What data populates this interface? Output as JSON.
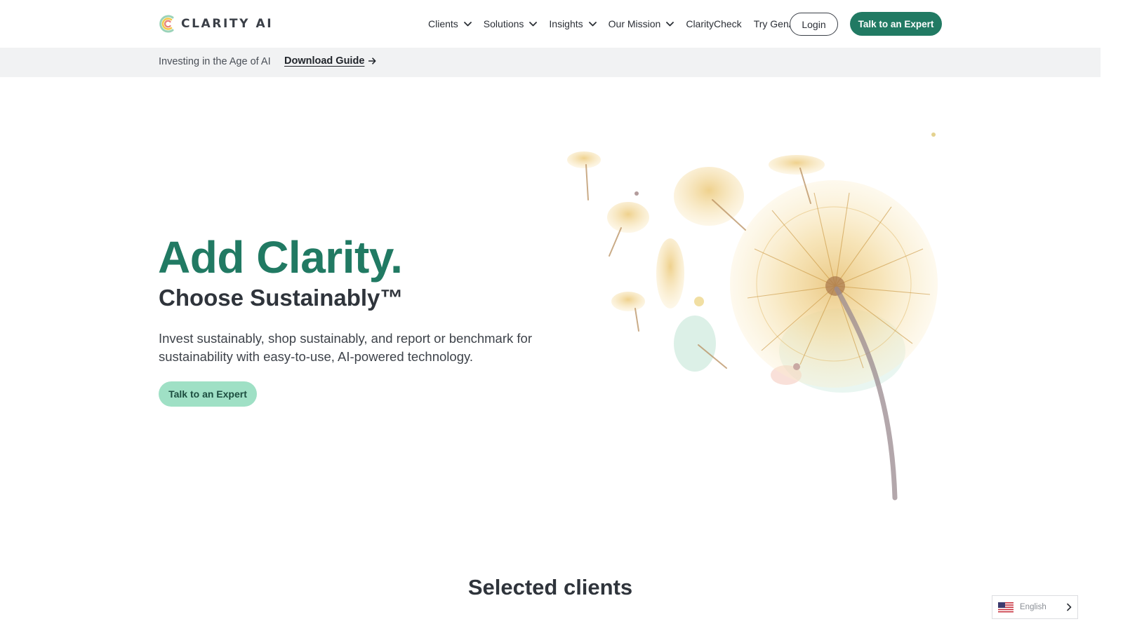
{
  "header": {
    "logo_text": "CLARITY AI",
    "nav": [
      {
        "label": "Clients",
        "has_dropdown": true
      },
      {
        "label": "Solutions",
        "has_dropdown": true
      },
      {
        "label": "Insights",
        "has_dropdown": true
      },
      {
        "label": "Our Mission",
        "has_dropdown": true
      },
      {
        "label": "ClarityCheck",
        "has_dropdown": false
      },
      {
        "label": "Try GenAI",
        "has_dropdown": false
      }
    ],
    "login_label": "Login",
    "cta_label": "Talk to an Expert"
  },
  "announcement": {
    "text": "Investing in the Age of AI",
    "link_label": "Download Guide"
  },
  "hero": {
    "title": "Add Clarity.",
    "subtitle": "Choose Sustainably™",
    "description": "Invest sustainably, shop sustainably, and report or benchmark for sustainability with easy-to-use, AI-powered technology.",
    "cta_label": "Talk to an Expert"
  },
  "clients_section": {
    "title": "Selected clients"
  },
  "language_selector": {
    "label": "English",
    "flag": "us-flag-icon"
  },
  "colors": {
    "brand_green": "#217a63",
    "mint": "#9fe0c5",
    "announce_bg": "#f1f2f3",
    "text_dark": "#2f343b"
  }
}
